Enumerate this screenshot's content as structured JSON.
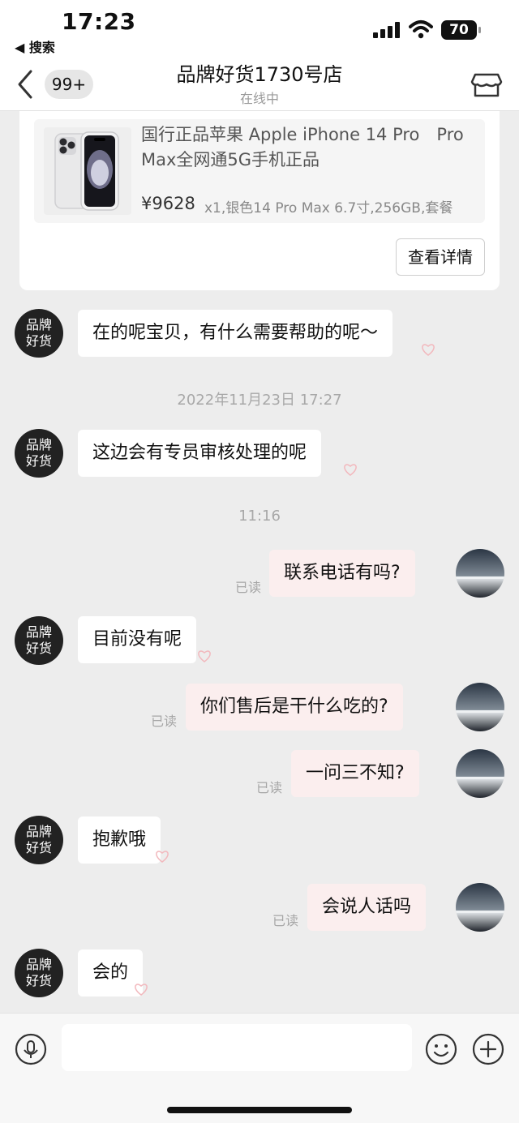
{
  "status_bar": {
    "time": "17:23",
    "back_app": "◀ 搜索",
    "battery": "70"
  },
  "nav": {
    "unread_count": "99+",
    "title": "品牌好货1730号店",
    "status": "在线中",
    "icons": {
      "back": "chevron-left-icon",
      "store": "store-icon"
    }
  },
  "product": {
    "title": "国行正品苹果 Apple iPhone 14 Pro　Pro Max全网通5G手机正品",
    "price": "¥9628",
    "spec": "x1,银色14 Pro Max 6.7寸,256GB,套餐",
    "detail_button": "查看详情"
  },
  "store_avatar": {
    "line1": "品牌",
    "line2": "好货"
  },
  "messages": {
    "m1": "在的呢宝贝，有什么需要帮助的呢～",
    "ts1": "2022年11月23日 17:27",
    "m2": "这边会有专员审核处理的呢",
    "ts2": "11:16",
    "m3": "联系电话有吗?",
    "m4": "目前没有呢",
    "m5": "你们售后是干什么吃的?",
    "m6": "一问三不知?",
    "m7": "抱歉哦",
    "m8": "会说人话吗",
    "m9": "会的",
    "read_label": "已读"
  },
  "input": {
    "placeholder": "",
    "icons": {
      "voice": "microphone-icon",
      "emoji": "emoji-icon",
      "plus": "plus-icon"
    }
  },
  "colors": {
    "background": "#ededed",
    "bubble_in": "#ffffff",
    "bubble_out": "#fbeeee",
    "avatar": "#222222"
  }
}
